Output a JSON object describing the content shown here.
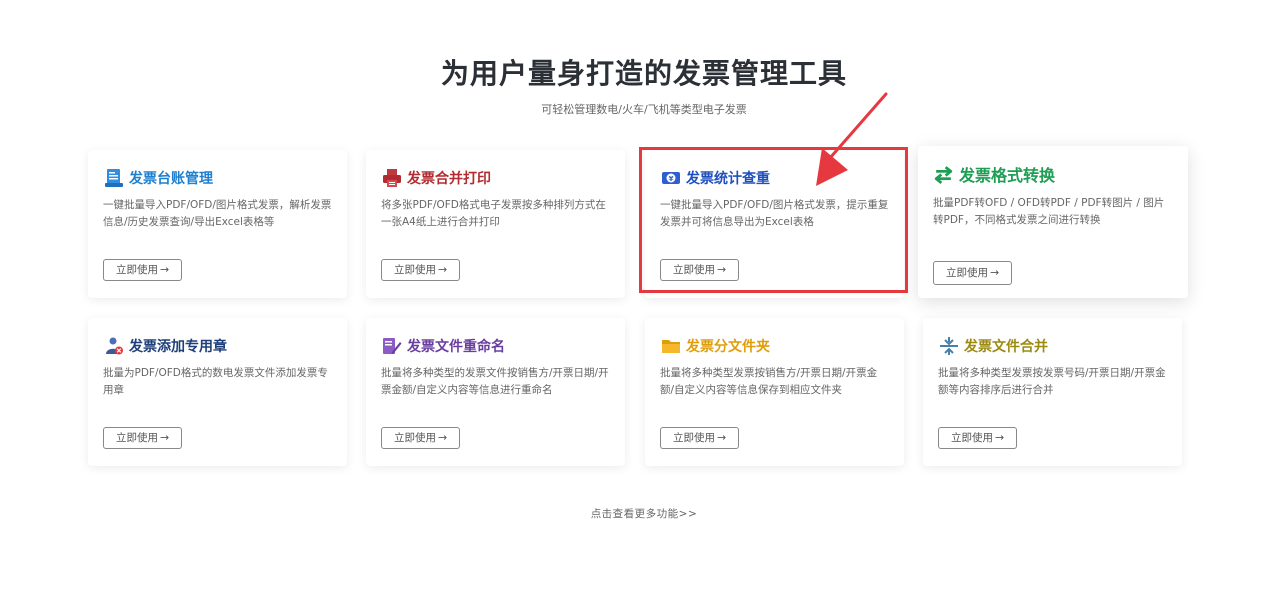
{
  "header": {
    "title": "为用户量身打造的发票管理工具",
    "subtitle": "可轻松管理数电/火车/飞机等类型电子发票"
  },
  "cards": [
    {
      "title": "发票台账管理",
      "title_color": "#1f80d0",
      "icon": "ledger-document-icon",
      "description": "一键批量导入PDF/OFD/图片格式发票，解析发票信息/历史发票查询/导出Excel表格等",
      "button": "立即使用"
    },
    {
      "title": "发票合并打印",
      "title_color": "#b12c31",
      "icon": "printer-icon",
      "description": "将多张PDF/OFD格式电子发票按多种排列方式在一张A4纸上进行合并打印",
      "button": "立即使用"
    },
    {
      "title": "发票统计查重",
      "title_color": "#1f4fbf",
      "icon": "yen-statistics-icon",
      "description": "一键批量导入PDF/OFD/图片格式发票，提示重复发票并可将信息导出为Excel表格",
      "button": "立即使用"
    },
    {
      "title": "发票格式转换",
      "title_color": "#1e9e53",
      "icon": "swap-arrows-icon",
      "description": "批量PDF转OFD / OFD转PDF / PDF转图片 / 图片转PDF，不同格式发票之间进行转换",
      "button": "立即使用"
    },
    {
      "title": "发票添加专用章",
      "title_color": "#1f3f7a",
      "icon": "stamp-user-icon",
      "description": "批量为PDF/OFD格式的数电发票文件添加发票专用章",
      "button": "立即使用"
    },
    {
      "title": "发票文件重命名",
      "title_color": "#6a3ea0",
      "icon": "rename-pen-icon",
      "description": "批量将多种类型的发票文件按销售方/开票日期/开票金额/自定义内容等信息进行重命名",
      "button": "立即使用"
    },
    {
      "title": "发票分文件夹",
      "title_color": "#e09d0a",
      "icon": "folder-icon",
      "description": "批量将多种类型发票按销售方/开票日期/开票金额/自定义内容等信息保存到相应文件夹",
      "button": "立即使用"
    },
    {
      "title": "发票文件合并",
      "title_color": "#9c8a12",
      "icon": "merge-icon",
      "description": "批量将多种类型发票按发票号码/开票日期/开票金额等内容排序后进行合并",
      "button": "立即使用"
    }
  ],
  "button_arrow": "→",
  "more_link": "点击查看更多功能>>",
  "highlight_color": "#e5393f"
}
